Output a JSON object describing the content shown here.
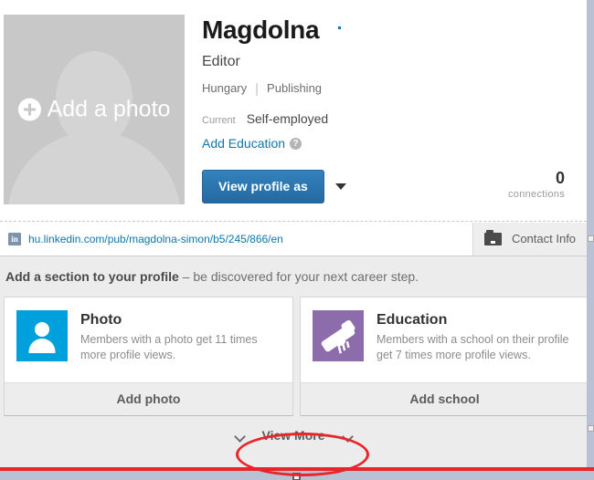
{
  "profile": {
    "name": "Magdolna",
    "headline": "Editor",
    "location": "Hungary",
    "industry": "Publishing",
    "meta_separator": "|",
    "current_label": "Current",
    "current_value": "Self-employed",
    "add_education_link": "Add Education",
    "help_icon_glyph": "?",
    "photo_placeholder_label": "Add a photo",
    "view_profile_as_button": "View profile as",
    "connections_count": "0",
    "connections_label": "connections"
  },
  "url_bar": {
    "linkedin_icon_text": "in",
    "public_url": "hu.linkedin.com/pub/magdolna-simon/b5/245/866/en",
    "contact_info_label": "Contact Info"
  },
  "add_section": {
    "heading_bold": "Add a section to your profile",
    "heading_rest": " – be discovered for your next career step.",
    "cards": [
      {
        "title": "Photo",
        "description": "Members with a photo get 11 times more profile views.",
        "action_label": "Add photo",
        "icon_name": "person-icon",
        "icon_color": "#00a0dc"
      },
      {
        "title": "Education",
        "description": "Members with a school on their profile get 7 times more profile views.",
        "action_label": "Add school",
        "icon_name": "diploma-icon",
        "icon_color": "#8d6cab"
      }
    ],
    "view_more_label": "View More"
  },
  "colors": {
    "linkedin_blue": "#0e76a8",
    "button_blue": "#2c77b0",
    "photo_icon_cyan": "#00a0dc",
    "education_icon_purple": "#8d6cab",
    "annotation_red": "#e8252a",
    "page_background": "#ececec"
  }
}
